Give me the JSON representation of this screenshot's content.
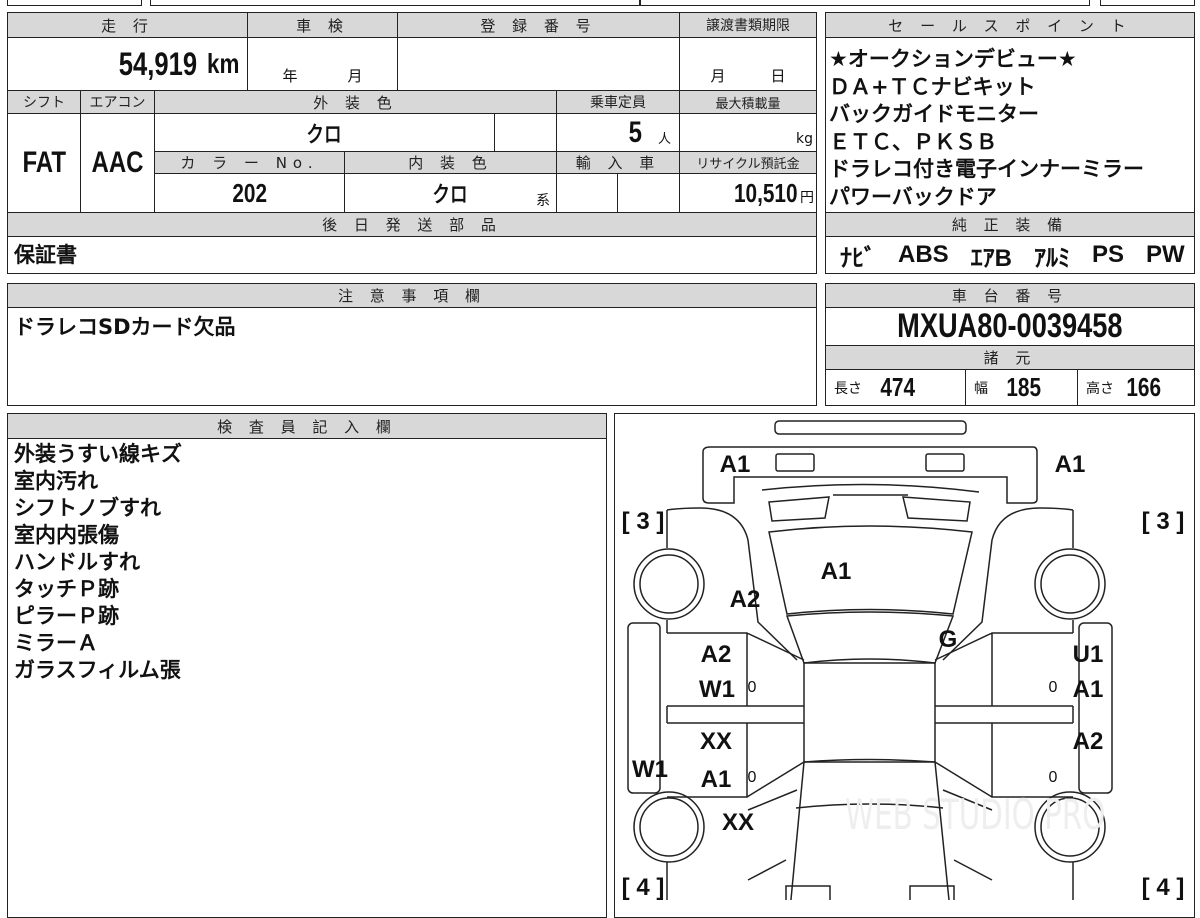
{
  "top": {
    "mileage_h": "走 行",
    "inspection_h": "車 検",
    "registration_h": "登 録 番 号",
    "transfer_deadline_h": "譲渡書類期限",
    "mileage": "54,919",
    "mileage_unit": "km",
    "year_unit": "年",
    "month_unit": "月",
    "transfer_month": "月",
    "transfer_day": "日"
  },
  "row2": {
    "shift_h": "シフト",
    "ac_h": "エアコン",
    "ext_color_h": "外 装 色",
    "capacity_h": "乗車定員",
    "max_load_h": "最大積載量",
    "shift": "FAT",
    "ac": "AAC",
    "ext_color": "クロ",
    "capacity": "5",
    "capacity_unit": "人",
    "max_load_unit": "kg",
    "color_no_h": "カ ラ ー No.",
    "int_color_h": "内 装 色",
    "import_h": "輸 入 車",
    "recycle_h": "リサイクル預託金",
    "color_no": "202",
    "int_color": "クロ",
    "int_color_suffix": "系",
    "recycle": "10,510",
    "recycle_unit": "円"
  },
  "later_parts": {
    "header": "後 日 発 送 部 品",
    "value": "保証書"
  },
  "sales": {
    "header": "セ ー ル ス ポ イ ン ト",
    "items": [
      "★オークションデビュー★",
      "ＤＡ+ＴＣナビキット",
      "バックガイドモニター",
      "ＥＴＣ、ＰＫＳＢ",
      "ドラレコ付き電子インナーミラー",
      "パワーバックドア"
    ]
  },
  "equipment": {
    "header": "純 正 装 備",
    "items": [
      "ﾅﾋﾞ",
      "ABS",
      "ｴｱB",
      "ｱﾙﾐ",
      "PS",
      "PW"
    ]
  },
  "notes": {
    "header": "注 意 事 項 欄",
    "value": "ドラレコSDカード欠品"
  },
  "chassis": {
    "header": "車 台 番 号",
    "value": "MXUA80-0039458"
  },
  "specs": {
    "header": "諸 元",
    "length_l": "長さ",
    "length": "474",
    "width_l": "幅",
    "width": "185",
    "height_l": "高さ",
    "height": "166"
  },
  "inspector": {
    "header": "検 査 員 記 入 欄",
    "items": [
      "外装うすい線キズ",
      "室内汚れ",
      "シフトノブすれ",
      "室内内張傷",
      "ハンドルすれ",
      "タッチＰ跡",
      "ピラーＰ跡",
      "ミラーＡ",
      "ガラスフィルム張"
    ]
  },
  "diagram": {
    "watermark": "WEB STUDIO PRO",
    "marks": [
      "A1",
      "A1",
      "[ 3 ]",
      "[ 3 ]",
      "A1",
      "A2",
      "G",
      "A2",
      "W1",
      "0",
      "U1",
      "0",
      "A1",
      "XX",
      "A2",
      "W1",
      "A1",
      "0",
      "0",
      "XX",
      "[ 4 ]",
      "[ 4 ]"
    ]
  }
}
